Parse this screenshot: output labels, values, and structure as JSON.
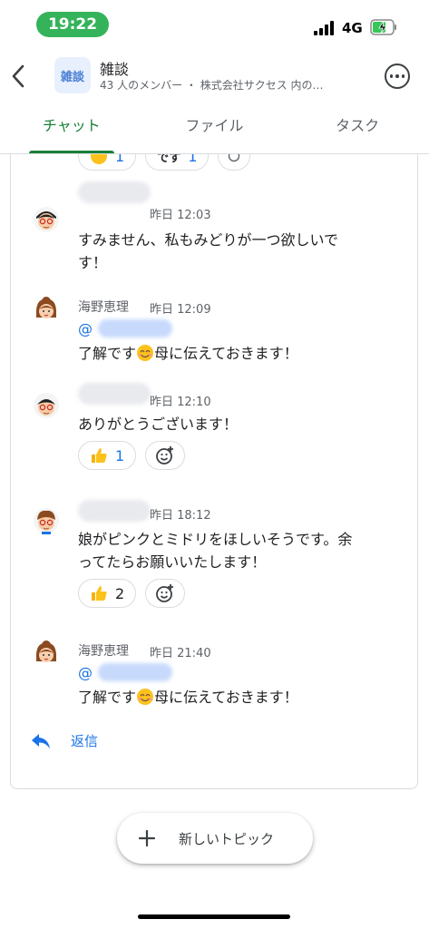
{
  "status_bar": {
    "time": "19:22",
    "network": "4G",
    "time_pill_color": "#34b35a",
    "battery_state": "charging"
  },
  "header": {
    "avatar_text": "雑談",
    "title": "雑談",
    "subtitle": "43 人のメンバー ・ 株式会社サクセス 内の…",
    "back_icon": "chevron-left-icon",
    "more_icon": "more-horizontal-icon"
  },
  "tabs": [
    {
      "label": "チャット",
      "active": true
    },
    {
      "label": "ファイル",
      "active": false
    },
    {
      "label": "タスク",
      "active": false
    }
  ],
  "accent_color": "#188038",
  "link_color": "#1a73e8",
  "partial_reactions": [
    {
      "emoji": "smile",
      "count": "1"
    },
    {
      "emoji": "sticker-desu",
      "label": "です",
      "count": "1"
    },
    {
      "emoji": "add-reaction"
    }
  ],
  "messages": [
    {
      "sender": "",
      "sender_hidden": true,
      "time": "昨日 12:03",
      "mention": null,
      "lines": [
        "すみません、私もみどりが一つ欲しいで",
        "す！"
      ],
      "reactions": []
    },
    {
      "sender": "海野恵理",
      "sender_hidden": false,
      "time": "昨日 12:09",
      "mention": "@",
      "text_before_emoji": "了解です",
      "text_after_emoji": "母に伝えておきます！",
      "reactions": []
    },
    {
      "sender": "",
      "sender_hidden": true,
      "time": "昨日 12:10",
      "mention": null,
      "lines": [
        "ありがとうございます！"
      ],
      "reactions": [
        {
          "emoji": "thumbs-up",
          "count": "1"
        }
      ]
    },
    {
      "sender": "",
      "sender_hidden": true,
      "time": "昨日 18:12",
      "mention": null,
      "lines": [
        "娘がピンクとミドリをほしいそうです。余",
        "ってたらお願いいたします！"
      ],
      "reactions": [
        {
          "emoji": "thumbs-up",
          "count": "2"
        }
      ]
    },
    {
      "sender": "海野恵理",
      "sender_hidden": false,
      "time": "昨日 21:40",
      "mention": "@",
      "text_before_emoji": "了解です",
      "text_after_emoji": "母に伝えておきます！",
      "reactions": []
    }
  ],
  "reply": {
    "label": "返信",
    "icon": "reply-icon"
  },
  "new_topic": {
    "label": "新しいトピック",
    "icon": "plus-icon"
  }
}
